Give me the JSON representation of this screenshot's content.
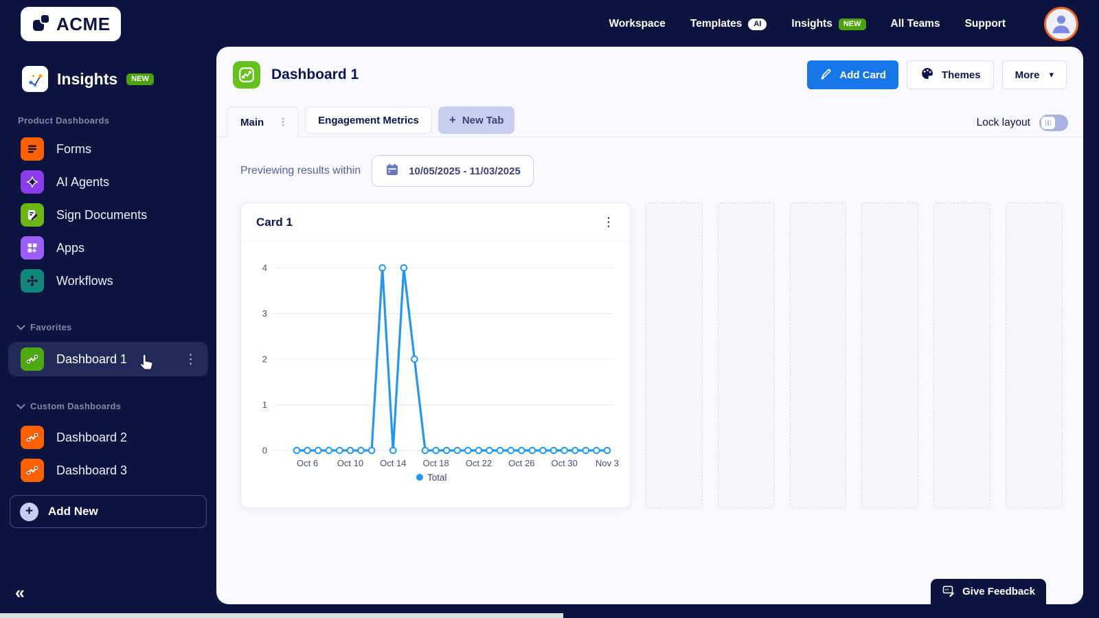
{
  "topnav": {
    "brand": "ACME",
    "items": [
      {
        "label": "Workspace"
      },
      {
        "label": "Templates",
        "badge": "AI"
      },
      {
        "label": "Insights",
        "badge": "NEW"
      },
      {
        "label": "All Teams"
      },
      {
        "label": "Support"
      }
    ]
  },
  "sidebar": {
    "app_title": "Insights",
    "app_badge": "NEW",
    "sections": {
      "product": "Product Dashboards",
      "favorites": "Favorites",
      "custom": "Custom Dashboards"
    },
    "product_items": [
      {
        "label": "Forms"
      },
      {
        "label": "AI Agents"
      },
      {
        "label": "Sign Documents"
      },
      {
        "label": "Apps"
      },
      {
        "label": "Workflows"
      }
    ],
    "favorite_items": [
      {
        "label": "Dashboard 1"
      }
    ],
    "custom_items": [
      {
        "label": "Dashboard 2"
      },
      {
        "label": "Dashboard 3"
      }
    ],
    "add_new_label": "Add New"
  },
  "main": {
    "title": "Dashboard 1",
    "buttons": {
      "add_card": "Add Card",
      "themes": "Themes",
      "more": "More"
    },
    "tabs": [
      {
        "label": "Main",
        "active": true
      },
      {
        "label": "Engagement Metrics",
        "active": false
      }
    ],
    "new_tab": {
      "label": "New Tab"
    },
    "lock_layout": {
      "label": "Lock layout",
      "enabled": false
    },
    "preview": {
      "label": "Previewing results within",
      "date_range": "10/05/2025 - 11/03/2025"
    },
    "card": {
      "title": "Card 1"
    },
    "feedback": {
      "label": "Give Feedback"
    }
  },
  "chart_data": {
    "type": "line",
    "title": "Card 1",
    "categories": [
      "Oct 5",
      "Oct 6",
      "Oct 7",
      "Oct 8",
      "Oct 9",
      "Oct 10",
      "Oct 11",
      "Oct 12",
      "Oct 13",
      "Oct 14",
      "Oct 15",
      "Oct 16",
      "Oct 17",
      "Oct 18",
      "Oct 19",
      "Oct 20",
      "Oct 21",
      "Oct 22",
      "Oct 23",
      "Oct 24",
      "Oct 25",
      "Oct 26",
      "Oct 27",
      "Oct 28",
      "Oct 29",
      "Oct 30",
      "Oct 31",
      "Nov 1",
      "Nov 2",
      "Nov 3"
    ],
    "x_tick_indices": [
      1,
      5,
      9,
      13,
      17,
      21,
      25,
      29
    ],
    "series": [
      {
        "name": "Total",
        "color": "#2196f3",
        "values": [
          0,
          0,
          0,
          0,
          0,
          0,
          0,
          0,
          4,
          0,
          4,
          2,
          0,
          0,
          0,
          0,
          0,
          0,
          0,
          0,
          0,
          0,
          0,
          0,
          0,
          0,
          0,
          0,
          0,
          0
        ]
      }
    ],
    "ylim": [
      0,
      4
    ],
    "yticks": [
      0,
      1,
      2,
      3,
      4
    ],
    "grid": true,
    "legend_position": "bottom",
    "xlabel": "",
    "ylabel": ""
  },
  "icons": {
    "kebab": "⋮",
    "caret_down": "▾",
    "collapse": "«",
    "plus": "+"
  },
  "colors": {
    "brand_navy": "#0e1440",
    "accent_blue": "#1877e8",
    "chart_blue": "#2196f3",
    "badge_green": "#4ca30d",
    "sidebar_dashboard_green": "#4fa80d",
    "header_green": "#65c21c",
    "orange": "#ff6100",
    "purple": "#8c3cea",
    "violet": "#9c5ffb",
    "teal": "#11877b",
    "avatar_ring": "#f0681f"
  }
}
